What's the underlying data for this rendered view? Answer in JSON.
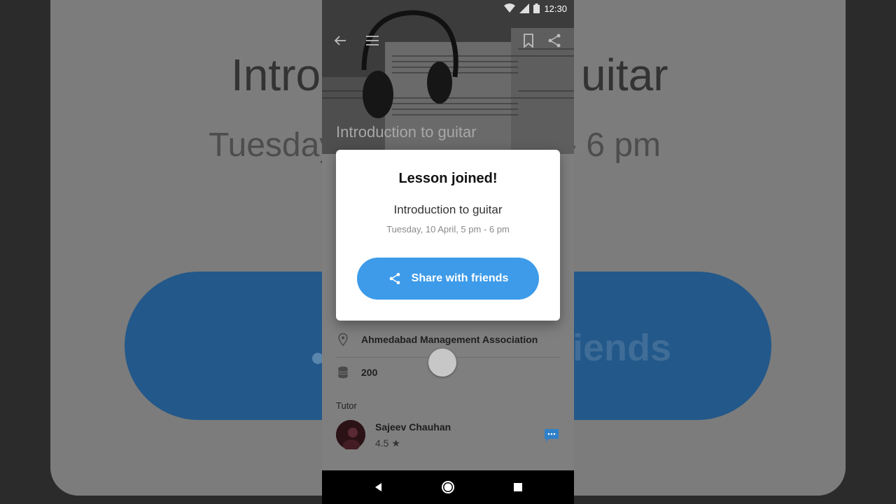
{
  "status_bar": {
    "time": "12:30"
  },
  "lesson": {
    "title": "Introduction to guitar",
    "schedule": "Tuesday, 10 April, 5 pm - 6 pm"
  },
  "details": {
    "location": "Ahmedabad Management Association",
    "price": "200"
  },
  "tutor": {
    "section_label": "Tutor",
    "name": "Sajeev Chauhan",
    "rating": "4.5 ★"
  },
  "dialog": {
    "title": "Lesson joined!",
    "lesson_title": "Introduction to guitar",
    "schedule": "Tuesday, 10 April, 5 pm - 6 pm",
    "share_label": "Share with friends"
  },
  "background": {
    "line1": "Intro",
    "line1_right": "uitar",
    "line2": "Tuesday",
    "line2_right": "- 6 pm",
    "pill_text": "iends"
  },
  "colors": {
    "accent": "#3d9be9",
    "chat_icon": "#2f80c9"
  },
  "icons": {
    "back": "arrow-back-icon",
    "menu": "hamburger-menu-icon",
    "bookmark": "bookmark-icon",
    "share": "share-icon",
    "location": "location-pin-icon",
    "coins": "coins-icon",
    "chat": "chat-bubble-icon"
  }
}
